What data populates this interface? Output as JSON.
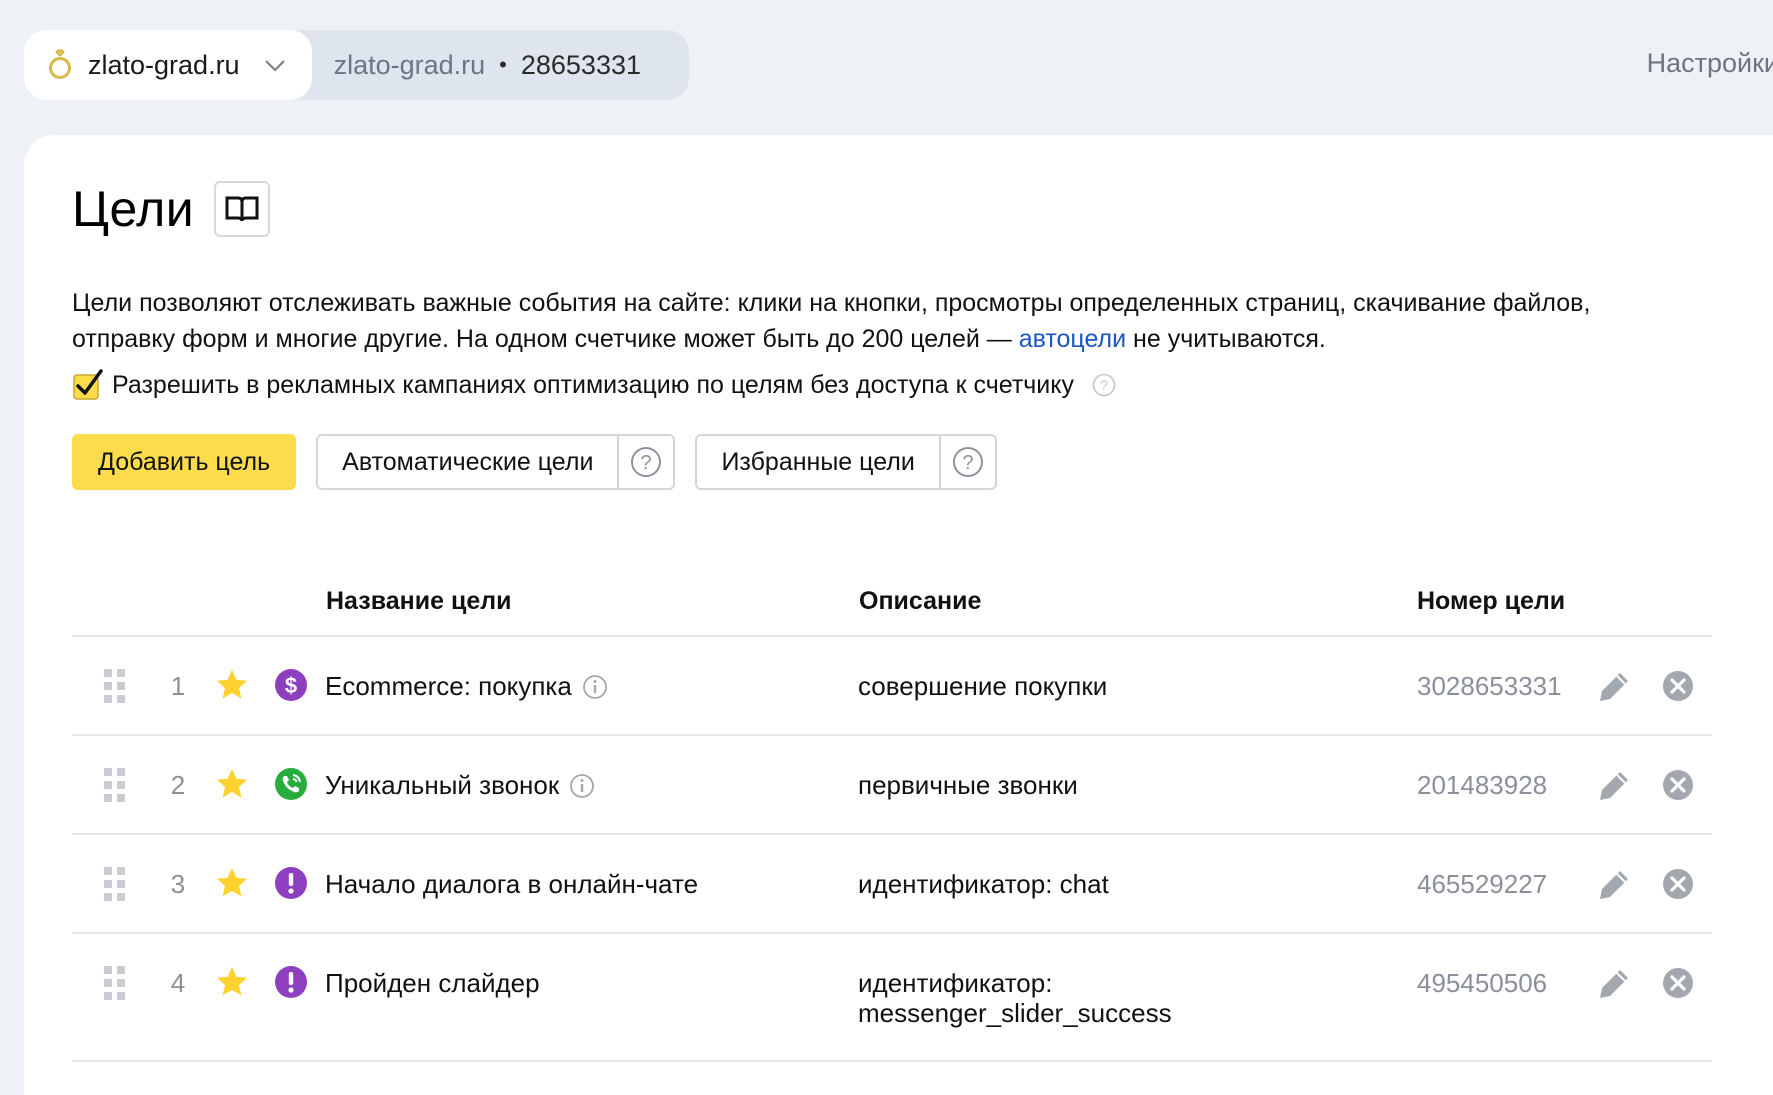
{
  "site_switcher": {
    "selected_site": "zlato-grad.ru",
    "domain": "zlato-grad.ru",
    "separator": "•",
    "counter_id": "28653331"
  },
  "settings_link": "Настройки",
  "page": {
    "title": "Цели",
    "description_part1": "Цели позволяют отслеживать важные события на сайте: клики на кнопки, просмотры определенных страниц, скачивание файлов, отправку форм и многие другие. На одном счетчике может быть до 200 целей — ",
    "description_link": "автоцели",
    "description_part2": " не учитываются.",
    "checkbox_label": "Разрешить в рекламных кампаниях оптимизацию по целям без доступа к счетчику",
    "checkbox_checked": true
  },
  "buttons": {
    "add_goal": "Добавить цель",
    "auto_goals": "Автоматические цели",
    "favorite_goals": "Избранные цели"
  },
  "table": {
    "columns": {
      "name": "Название цели",
      "description": "Описание",
      "goal_id": "Номер цели"
    },
    "rows": [
      {
        "number": "1",
        "name": "Ecommerce: покупка",
        "type_icon": "ecommerce-icon",
        "has_info": true,
        "description": "совершение покупки",
        "goal_id": "3028653331",
        "favorite": true
      },
      {
        "number": "2",
        "name": "Уникальный звонок",
        "type_icon": "phone-call-icon",
        "has_info": true,
        "description": "первичные звонки",
        "goal_id": "201483928",
        "favorite": true
      },
      {
        "number": "3",
        "name": "Начало диалога в онлайн-чате",
        "type_icon": "exclamation-icon",
        "has_info": false,
        "description": "идентификатор: chat",
        "goal_id": "465529227",
        "favorite": true
      },
      {
        "number": "4",
        "name": "Пройден слайдер",
        "type_icon": "exclamation-icon",
        "has_info": false,
        "description_line1": "идентификатор:",
        "description_line2": "messenger_slider_success",
        "goal_id": "495450506",
        "favorite": true
      }
    ]
  },
  "colors": {
    "accent_yellow": "#fddc4b",
    "star": "#ffd230",
    "ecommerce_purple": "#8e3fbf",
    "call_green": "#27ad3e",
    "link": "#1a56c4"
  }
}
